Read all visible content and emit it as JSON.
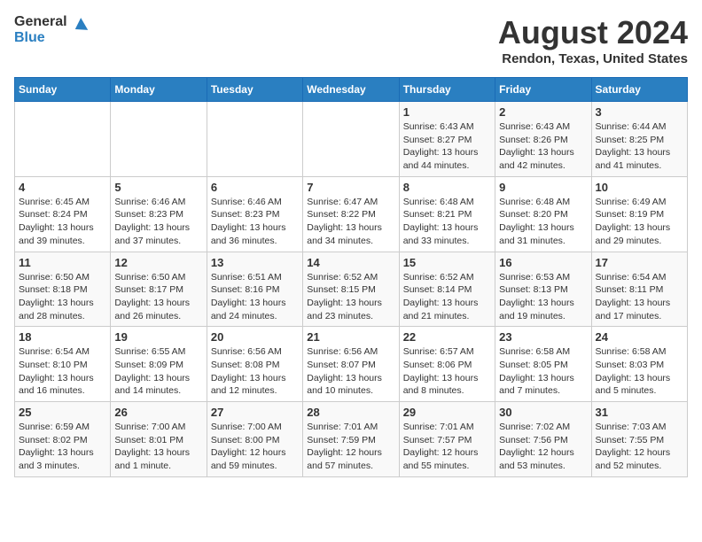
{
  "header": {
    "logo_line1": "General",
    "logo_line2": "Blue",
    "title": "August 2024",
    "subtitle": "Rendon, Texas, United States"
  },
  "calendar": {
    "days_of_week": [
      "Sunday",
      "Monday",
      "Tuesday",
      "Wednesday",
      "Thursday",
      "Friday",
      "Saturday"
    ],
    "weeks": [
      [
        {
          "day": "",
          "info": ""
        },
        {
          "day": "",
          "info": ""
        },
        {
          "day": "",
          "info": ""
        },
        {
          "day": "",
          "info": ""
        },
        {
          "day": "1",
          "info": "Sunrise: 6:43 AM\nSunset: 8:27 PM\nDaylight: 13 hours\nand 44 minutes."
        },
        {
          "day": "2",
          "info": "Sunrise: 6:43 AM\nSunset: 8:26 PM\nDaylight: 13 hours\nand 42 minutes."
        },
        {
          "day": "3",
          "info": "Sunrise: 6:44 AM\nSunset: 8:25 PM\nDaylight: 13 hours\nand 41 minutes."
        }
      ],
      [
        {
          "day": "4",
          "info": "Sunrise: 6:45 AM\nSunset: 8:24 PM\nDaylight: 13 hours\nand 39 minutes."
        },
        {
          "day": "5",
          "info": "Sunrise: 6:46 AM\nSunset: 8:23 PM\nDaylight: 13 hours\nand 37 minutes."
        },
        {
          "day": "6",
          "info": "Sunrise: 6:46 AM\nSunset: 8:23 PM\nDaylight: 13 hours\nand 36 minutes."
        },
        {
          "day": "7",
          "info": "Sunrise: 6:47 AM\nSunset: 8:22 PM\nDaylight: 13 hours\nand 34 minutes."
        },
        {
          "day": "8",
          "info": "Sunrise: 6:48 AM\nSunset: 8:21 PM\nDaylight: 13 hours\nand 33 minutes."
        },
        {
          "day": "9",
          "info": "Sunrise: 6:48 AM\nSunset: 8:20 PM\nDaylight: 13 hours\nand 31 minutes."
        },
        {
          "day": "10",
          "info": "Sunrise: 6:49 AM\nSunset: 8:19 PM\nDaylight: 13 hours\nand 29 minutes."
        }
      ],
      [
        {
          "day": "11",
          "info": "Sunrise: 6:50 AM\nSunset: 8:18 PM\nDaylight: 13 hours\nand 28 minutes."
        },
        {
          "day": "12",
          "info": "Sunrise: 6:50 AM\nSunset: 8:17 PM\nDaylight: 13 hours\nand 26 minutes."
        },
        {
          "day": "13",
          "info": "Sunrise: 6:51 AM\nSunset: 8:16 PM\nDaylight: 13 hours\nand 24 minutes."
        },
        {
          "day": "14",
          "info": "Sunrise: 6:52 AM\nSunset: 8:15 PM\nDaylight: 13 hours\nand 23 minutes."
        },
        {
          "day": "15",
          "info": "Sunrise: 6:52 AM\nSunset: 8:14 PM\nDaylight: 13 hours\nand 21 minutes."
        },
        {
          "day": "16",
          "info": "Sunrise: 6:53 AM\nSunset: 8:13 PM\nDaylight: 13 hours\nand 19 minutes."
        },
        {
          "day": "17",
          "info": "Sunrise: 6:54 AM\nSunset: 8:11 PM\nDaylight: 13 hours\nand 17 minutes."
        }
      ],
      [
        {
          "day": "18",
          "info": "Sunrise: 6:54 AM\nSunset: 8:10 PM\nDaylight: 13 hours\nand 16 minutes."
        },
        {
          "day": "19",
          "info": "Sunrise: 6:55 AM\nSunset: 8:09 PM\nDaylight: 13 hours\nand 14 minutes."
        },
        {
          "day": "20",
          "info": "Sunrise: 6:56 AM\nSunset: 8:08 PM\nDaylight: 13 hours\nand 12 minutes."
        },
        {
          "day": "21",
          "info": "Sunrise: 6:56 AM\nSunset: 8:07 PM\nDaylight: 13 hours\nand 10 minutes."
        },
        {
          "day": "22",
          "info": "Sunrise: 6:57 AM\nSunset: 8:06 PM\nDaylight: 13 hours\nand 8 minutes."
        },
        {
          "day": "23",
          "info": "Sunrise: 6:58 AM\nSunset: 8:05 PM\nDaylight: 13 hours\nand 7 minutes."
        },
        {
          "day": "24",
          "info": "Sunrise: 6:58 AM\nSunset: 8:03 PM\nDaylight: 13 hours\nand 5 minutes."
        }
      ],
      [
        {
          "day": "25",
          "info": "Sunrise: 6:59 AM\nSunset: 8:02 PM\nDaylight: 13 hours\nand 3 minutes."
        },
        {
          "day": "26",
          "info": "Sunrise: 7:00 AM\nSunset: 8:01 PM\nDaylight: 13 hours\nand 1 minute."
        },
        {
          "day": "27",
          "info": "Sunrise: 7:00 AM\nSunset: 8:00 PM\nDaylight: 12 hours\nand 59 minutes."
        },
        {
          "day": "28",
          "info": "Sunrise: 7:01 AM\nSunset: 7:59 PM\nDaylight: 12 hours\nand 57 minutes."
        },
        {
          "day": "29",
          "info": "Sunrise: 7:01 AM\nSunset: 7:57 PM\nDaylight: 12 hours\nand 55 minutes."
        },
        {
          "day": "30",
          "info": "Sunrise: 7:02 AM\nSunset: 7:56 PM\nDaylight: 12 hours\nand 53 minutes."
        },
        {
          "day": "31",
          "info": "Sunrise: 7:03 AM\nSunset: 7:55 PM\nDaylight: 12 hours\nand 52 minutes."
        }
      ]
    ]
  }
}
